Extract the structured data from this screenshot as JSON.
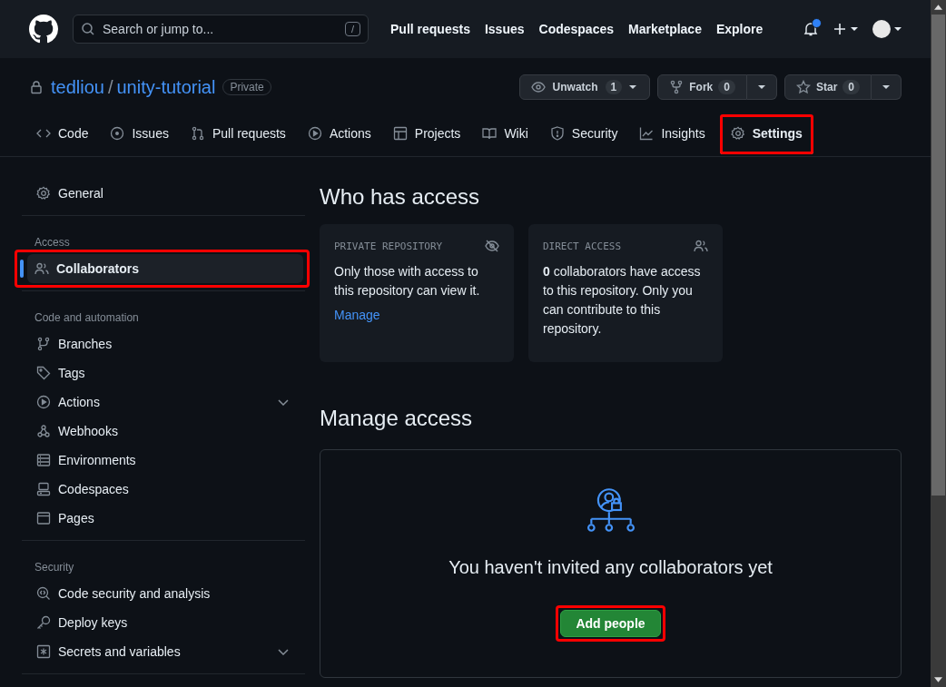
{
  "header": {
    "search": {
      "placeholder": "Search or jump to...",
      "shortcut": "/"
    },
    "nav": [
      "Pull requests",
      "Issues",
      "Codespaces",
      "Marketplace",
      "Explore"
    ],
    "notification": true
  },
  "repo": {
    "owner": "tedliou",
    "separator": "/",
    "name": "unity-tutorial",
    "visibility": "Private",
    "actions": [
      {
        "label": "Unwatch",
        "count": "1"
      },
      {
        "label": "Fork",
        "count": "0"
      },
      {
        "label": "Star",
        "count": "0"
      }
    ]
  },
  "tabs": [
    {
      "label": "Code",
      "selected": false,
      "highlighted": false
    },
    {
      "label": "Issues",
      "selected": false,
      "highlighted": false
    },
    {
      "label": "Pull requests",
      "selected": false,
      "highlighted": false
    },
    {
      "label": "Actions",
      "selected": false,
      "highlighted": false
    },
    {
      "label": "Projects",
      "selected": false,
      "highlighted": false
    },
    {
      "label": "Wiki",
      "selected": false,
      "highlighted": false
    },
    {
      "label": "Security",
      "selected": false,
      "highlighted": false
    },
    {
      "label": "Insights",
      "selected": false,
      "highlighted": false
    },
    {
      "label": "Settings",
      "selected": true,
      "highlighted": true
    }
  ],
  "sidebar": {
    "groups": [
      {
        "items": [
          {
            "label": "General",
            "selected": false,
            "highlighted": false,
            "has_submenu": false
          }
        ]
      },
      {
        "heading": "Access",
        "items": [
          {
            "label": "Collaborators",
            "selected": true,
            "highlighted": true,
            "has_submenu": false
          }
        ]
      },
      {
        "heading": "Code and automation",
        "items": [
          {
            "label": "Branches",
            "selected": false,
            "highlighted": false,
            "has_submenu": false
          },
          {
            "label": "Tags",
            "selected": false,
            "highlighted": false,
            "has_submenu": false
          },
          {
            "label": "Actions",
            "selected": false,
            "highlighted": false,
            "has_submenu": true
          },
          {
            "label": "Webhooks",
            "selected": false,
            "highlighted": false,
            "has_submenu": false
          },
          {
            "label": "Environments",
            "selected": false,
            "highlighted": false,
            "has_submenu": false
          },
          {
            "label": "Codespaces",
            "selected": false,
            "highlighted": false,
            "has_submenu": false
          },
          {
            "label": "Pages",
            "selected": false,
            "highlighted": false,
            "has_submenu": false
          }
        ]
      },
      {
        "heading": "Security",
        "items": [
          {
            "label": "Code security and analysis",
            "selected": false,
            "highlighted": false,
            "has_submenu": false
          },
          {
            "label": "Deploy keys",
            "selected": false,
            "highlighted": false,
            "has_submenu": false
          },
          {
            "label": "Secrets and variables",
            "selected": false,
            "highlighted": false,
            "has_submenu": true
          }
        ]
      }
    ]
  },
  "who_has_access": {
    "title": "Who has access",
    "cards": [
      {
        "title": "PRIVATE REPOSITORY",
        "text": "Only those with access to this repository can view it.",
        "link": "Manage"
      },
      {
        "title": "DIRECT ACCESS",
        "text": "**0** collaborators have access to this repository. Only you can contribute to this repository."
      }
    ]
  },
  "manage_access": {
    "title": "Manage access",
    "empty_text": "You haven't invited any collaborators yet",
    "button": {
      "label": "Add people",
      "highlighted": true
    }
  }
}
